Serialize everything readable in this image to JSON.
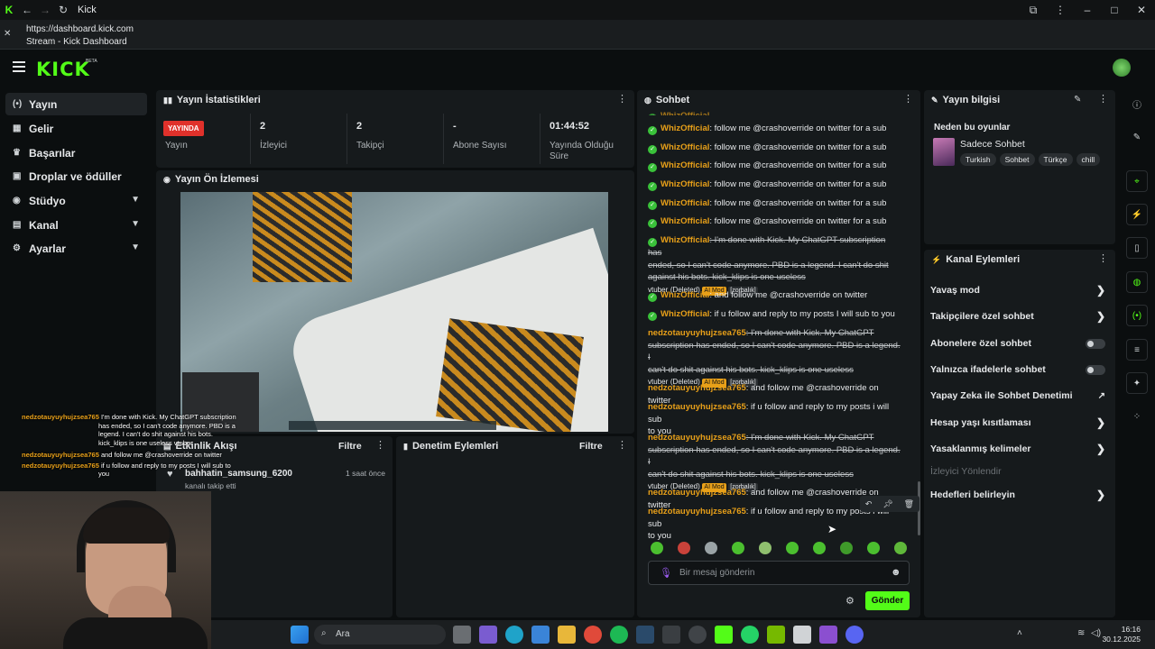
{
  "browser": {
    "app_title": "Kick",
    "url": "https://dashboard.kick.com",
    "page_title": "Stream - Kick Dashboard"
  },
  "brand": {
    "logo": "KICK",
    "beta": "BETA",
    "accent": "#53fc18"
  },
  "sidebar": {
    "items": [
      {
        "label": "Yayın",
        "icon": "broadcast-icon"
      },
      {
        "label": "Gelir",
        "icon": "money-icon"
      },
      {
        "label": "Başarılar",
        "icon": "trophy-icon"
      },
      {
        "label": "Droplar ve ödüller",
        "icon": "gift-icon"
      },
      {
        "label": "Stüdyo",
        "icon": "camera-icon"
      },
      {
        "label": "Kanal",
        "icon": "channel-icon"
      },
      {
        "label": "Ayarlar",
        "icon": "gear-icon"
      }
    ]
  },
  "stats": {
    "title": "Yayın İstatistikleri",
    "live_badge": "YAYINDA",
    "live_label": "Yayın",
    "viewers_value": "2",
    "viewers_label": "İzleyici",
    "followers_value": "2",
    "followers_label": "Takipçi",
    "subs_value": "-",
    "subs_label": "Abone Sayısı",
    "uptime_value": "01:44:52",
    "uptime_label_1": "Yayında Olduğu",
    "uptime_label_2": "Süre"
  },
  "preview": {
    "title": "Yayın Ön İzlemesi"
  },
  "activity": {
    "title": "Etkinlik Akışı",
    "filter": "Filtre",
    "user": "bahhatin_samsung_6200",
    "time": "1 saat önce",
    "desc": "kanalı takip etti"
  },
  "moderation": {
    "title": "Denetim Eylemleri",
    "filter": "Filtre"
  },
  "chat": {
    "title": "Sohbet",
    "partial_top": "WhizOfficial: follow me @crashoverride on twitter for a sub",
    "whiz": "WhizOfficial",
    "nedz": "nedzotauyuyhujzsea765",
    "msg_follow": ": follow me @crashoverride on twitter for a sub",
    "msg_deleted_a": ": I'm done with Kick. My ChatGPT subscription has",
    "msg_deleted_b": "ended, so I can't code anymore. PBD is a legend. I can't do shit",
    "msg_deleted_c": "against his bots. kick_klips is one useless",
    "msg_deleted_n1": ": I'm done with Kick. My ChatGPT",
    "msg_deleted_n2": "subscription has ended, so I can't code anymore. PBD is a legend. I",
    "msg_deleted_n3": "can't do shit against his bots. kick_klips is one useless",
    "vtuber": "vtuber",
    "deleted": "(Deleted)",
    "ai_mod": "AI Mod",
    "zorbalik": "[zorbalık]",
    "msg_and_follow": ": and follow me @crashoverride on twitter",
    "msg_if_u": ": if u follow and reply to my posts I will sub to you",
    "msg_if_u_lower_1": ": if u follow and reply to my posts i will sub",
    "msg_if_u_lower_2": "to you",
    "msg_last_1": ": if u follow and reply to my posts i will sub",
    "input_placeholder": "Bir mesaj gönderin",
    "send": "Gönder"
  },
  "stream_info": {
    "title": "Yayın bilgisi",
    "question": "Neden bu oyunlar",
    "category": "Sadece Sohbet",
    "tags": [
      "Turkish",
      "Sohbet",
      "Türkçe",
      "chill"
    ]
  },
  "channel_actions": {
    "title": "Kanal Eylemleri",
    "items": [
      {
        "label": "Yavaş mod",
        "kind": "arrow"
      },
      {
        "label": "Takipçilere özel sohbet",
        "kind": "arrow"
      },
      {
        "label": "Abonelere özel sohbet",
        "kind": "toggle"
      },
      {
        "label": "Yalnızca ifadelerle sohbet",
        "kind": "toggle"
      },
      {
        "label": "Yapay Zeka ile Sohbet Denetimi",
        "kind": "link"
      },
      {
        "label": "Hesap yaşı kısıtlaması",
        "kind": "arrow"
      },
      {
        "label": "Yasaklanmış kelimeler",
        "kind": "arrow"
      },
      {
        "label": "İzleyici Yönlendir",
        "kind": "disabled"
      },
      {
        "label": "Hedefleri belirleyin",
        "kind": "arrow"
      }
    ]
  },
  "overlay_chat": {
    "user": "nedzotauyuyhujzsea765",
    "l1": "I'm done with Kick. My ChatGPT subscription",
    "l2": "has ended, so I can't code anymore. PBD is a",
    "l3": "legend. I can't do shit against his bots.",
    "l4": "kick_klips is one useless vtuber",
    "l5": "and follow me @crashoverride on twitter",
    "l6": "if u follow and reply to my posts I will sub to",
    "l7": "you"
  },
  "taskbar": {
    "search": "Ara",
    "time": "16:16",
    "date": "30.12.2025"
  }
}
